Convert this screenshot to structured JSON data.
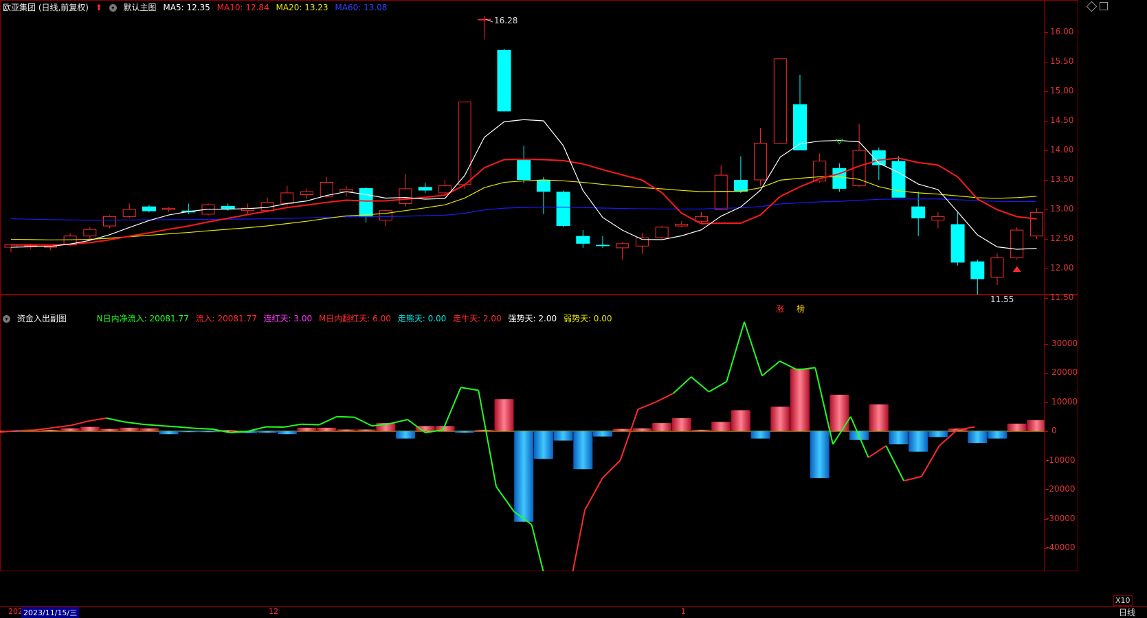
{
  "main_header": {
    "stock_title": "欧亚集团 (日线,前复权)",
    "chart_name": "默认主图",
    "ma5": "MA5: 12.35",
    "ma10": "MA10: 12.84",
    "ma20": "MA20: 13.23",
    "ma60": "MA60: 13.08"
  },
  "sub_header": {
    "chart_name": "资金入出副图",
    "n_day_net": "N日内净流入: 20081.77",
    "inflow": "流入: 20081.77",
    "red_days": "连红天: 3.00",
    "m_red_days": "M日内翻红天: 6.00",
    "bear_days": "走熊天: 0.00",
    "bull_days": "走牛天: 2.00",
    "strong_days": "强势天: 2.00",
    "weak_days": "弱势天: 0.00"
  },
  "price_axis": [
    "16.00",
    "15.50",
    "15.00",
    "14.50",
    "14.00",
    "13.50",
    "13.00",
    "12.50",
    "12.00",
    "11.50"
  ],
  "flow_axis": [
    "30000",
    "20000",
    "10000",
    "0",
    "-10000",
    "-20000",
    "-30000",
    "-40000"
  ],
  "annotations": {
    "high": "16.28",
    "low": "11.55",
    "zhang": "涨",
    "bang": "榜"
  },
  "bottom_bar": {
    "year": "202",
    "date": "2023/11/15/三",
    "dec": "12",
    "jan": "1",
    "zoom": "X10",
    "period": "日线"
  },
  "colors": {
    "up": "#ff2a2a",
    "down": "#00ffff",
    "ma5": "#ffffff",
    "ma10": "#ff1a1a",
    "ma20": "#e6e600",
    "ma60": "#1a1aff",
    "flow_line": "#20ff20",
    "flow_pos": "#ff1e3c",
    "flow_neg": "#1e90ff"
  },
  "chart_data": [
    {
      "type": "candlestick",
      "ylim": [
        11.5,
        16.28
      ],
      "candles": [
        [
          12.36,
          12.4,
          12.28,
          12.4
        ],
        [
          12.38,
          12.42,
          12.33,
          12.39
        ],
        [
          12.36,
          12.41,
          12.31,
          12.38
        ],
        [
          12.4,
          12.6,
          12.38,
          12.55
        ],
        [
          12.55,
          12.7,
          12.5,
          12.66
        ],
        [
          12.72,
          12.9,
          12.68,
          12.88
        ],
        [
          12.88,
          13.1,
          12.85,
          13.0
        ],
        [
          13.05,
          13.08,
          12.95,
          12.97
        ],
        [
          13.0,
          13.04,
          12.96,
          13.02
        ],
        [
          12.98,
          13.1,
          12.92,
          12.95
        ],
        [
          12.92,
          13.1,
          12.9,
          13.08
        ],
        [
          13.06,
          13.1,
          12.98,
          13.0
        ],
        [
          12.98,
          13.1,
          12.92,
          13.02
        ],
        [
          12.98,
          13.2,
          12.95,
          13.12
        ],
        [
          13.1,
          13.4,
          13.05,
          13.28
        ],
        [
          13.25,
          13.35,
          13.18,
          13.3
        ],
        [
          13.22,
          13.55,
          13.2,
          13.46
        ],
        [
          13.3,
          13.4,
          13.22,
          13.34
        ],
        [
          13.36,
          13.38,
          12.78,
          12.88
        ],
        [
          12.82,
          13.0,
          12.72,
          12.98
        ],
        [
          13.1,
          13.6,
          13.05,
          13.35
        ],
        [
          13.38,
          13.45,
          13.28,
          13.32
        ],
        [
          13.28,
          13.5,
          13.25,
          13.4
        ],
        [
          13.42,
          14.82,
          13.35,
          14.82
        ],
        [
          16.22,
          16.28,
          15.88,
          16.22
        ],
        [
          15.7,
          15.72,
          14.66,
          14.66
        ],
        [
          13.85,
          14.08,
          13.45,
          13.5
        ],
        [
          13.5,
          13.55,
          12.92,
          13.3
        ],
        [
          13.3,
          13.32,
          12.7,
          12.72
        ],
        [
          12.55,
          12.65,
          12.35,
          12.42
        ],
        [
          12.4,
          12.55,
          12.35,
          12.38
        ],
        [
          12.35,
          12.45,
          12.15,
          12.42
        ],
        [
          12.38,
          12.6,
          12.25,
          12.52
        ],
        [
          12.52,
          12.72,
          12.5,
          12.7
        ],
        [
          12.72,
          12.8,
          12.7,
          12.75
        ],
        [
          12.8,
          12.95,
          12.75,
          12.88
        ],
        [
          13.0,
          13.75,
          13.0,
          13.58
        ],
        [
          13.5,
          13.9,
          13.28,
          13.3
        ],
        [
          13.5,
          14.38,
          13.4,
          14.12
        ],
        [
          14.12,
          15.55,
          14.12,
          15.55
        ],
        [
          14.78,
          15.28,
          14.0,
          14.0
        ],
        [
          13.48,
          13.95,
          13.45,
          13.82
        ],
        [
          13.7,
          13.78,
          13.3,
          13.35
        ],
        [
          13.4,
          14.45,
          13.38,
          14.0
        ],
        [
          14.0,
          14.05,
          13.5,
          13.75
        ],
        [
          13.82,
          13.9,
          13.22,
          13.2
        ],
        [
          13.05,
          13.3,
          12.55,
          12.85
        ],
        [
          12.82,
          12.95,
          12.68,
          12.88
        ],
        [
          12.75,
          12.95,
          12.05,
          12.1
        ],
        [
          12.12,
          12.15,
          11.55,
          11.82
        ],
        [
          11.85,
          12.25,
          11.72,
          12.18
        ],
        [
          12.18,
          12.7,
          12.15,
          12.65
        ],
        [
          12.55,
          13.02,
          12.5,
          12.95
        ]
      ]
    },
    {
      "type": "bar",
      "ylim": [
        -48000,
        40000
      ],
      "net_flow": [
        -200,
        300,
        500,
        1000,
        1500,
        800,
        1200,
        1000,
        -1000,
        -300,
        -300,
        400,
        -600,
        -500,
        -1000,
        1200,
        1200,
        600,
        600,
        2800,
        -2500,
        1800,
        1800,
        -500,
        500,
        11000,
        -31000,
        -9500,
        -3200,
        -13000,
        -1800,
        800,
        1000,
        2800,
        4500,
        500,
        3200,
        7200,
        -2500,
        8400,
        21500,
        -16000,
        12500,
        -3000,
        9200,
        -4500,
        -7000,
        -2000,
        900,
        -4000,
        -2500,
        2600,
        3800,
        1600
      ],
      "cumulative_line": [
        -300,
        200,
        400,
        1200,
        2000,
        3500,
        4500,
        3200,
        2400,
        1900,
        1500,
        1000,
        700,
        -500,
        0,
        1500,
        1400,
        2400,
        2200,
        5000,
        4800,
        1800,
        2600,
        4000,
        -500,
        500,
        15000,
        14000,
        -19000,
        -27500,
        -32000,
        -56500,
        -58000,
        -27000,
        -16000,
        -10000,
        7500,
        10000,
        13000,
        18600,
        13500,
        17000,
        37500,
        19000,
        24000,
        21000,
        21800,
        -4500,
        5000,
        -9000,
        -5000,
        -17000,
        -15500,
        -5000,
        400,
        1500
      ]
    }
  ]
}
